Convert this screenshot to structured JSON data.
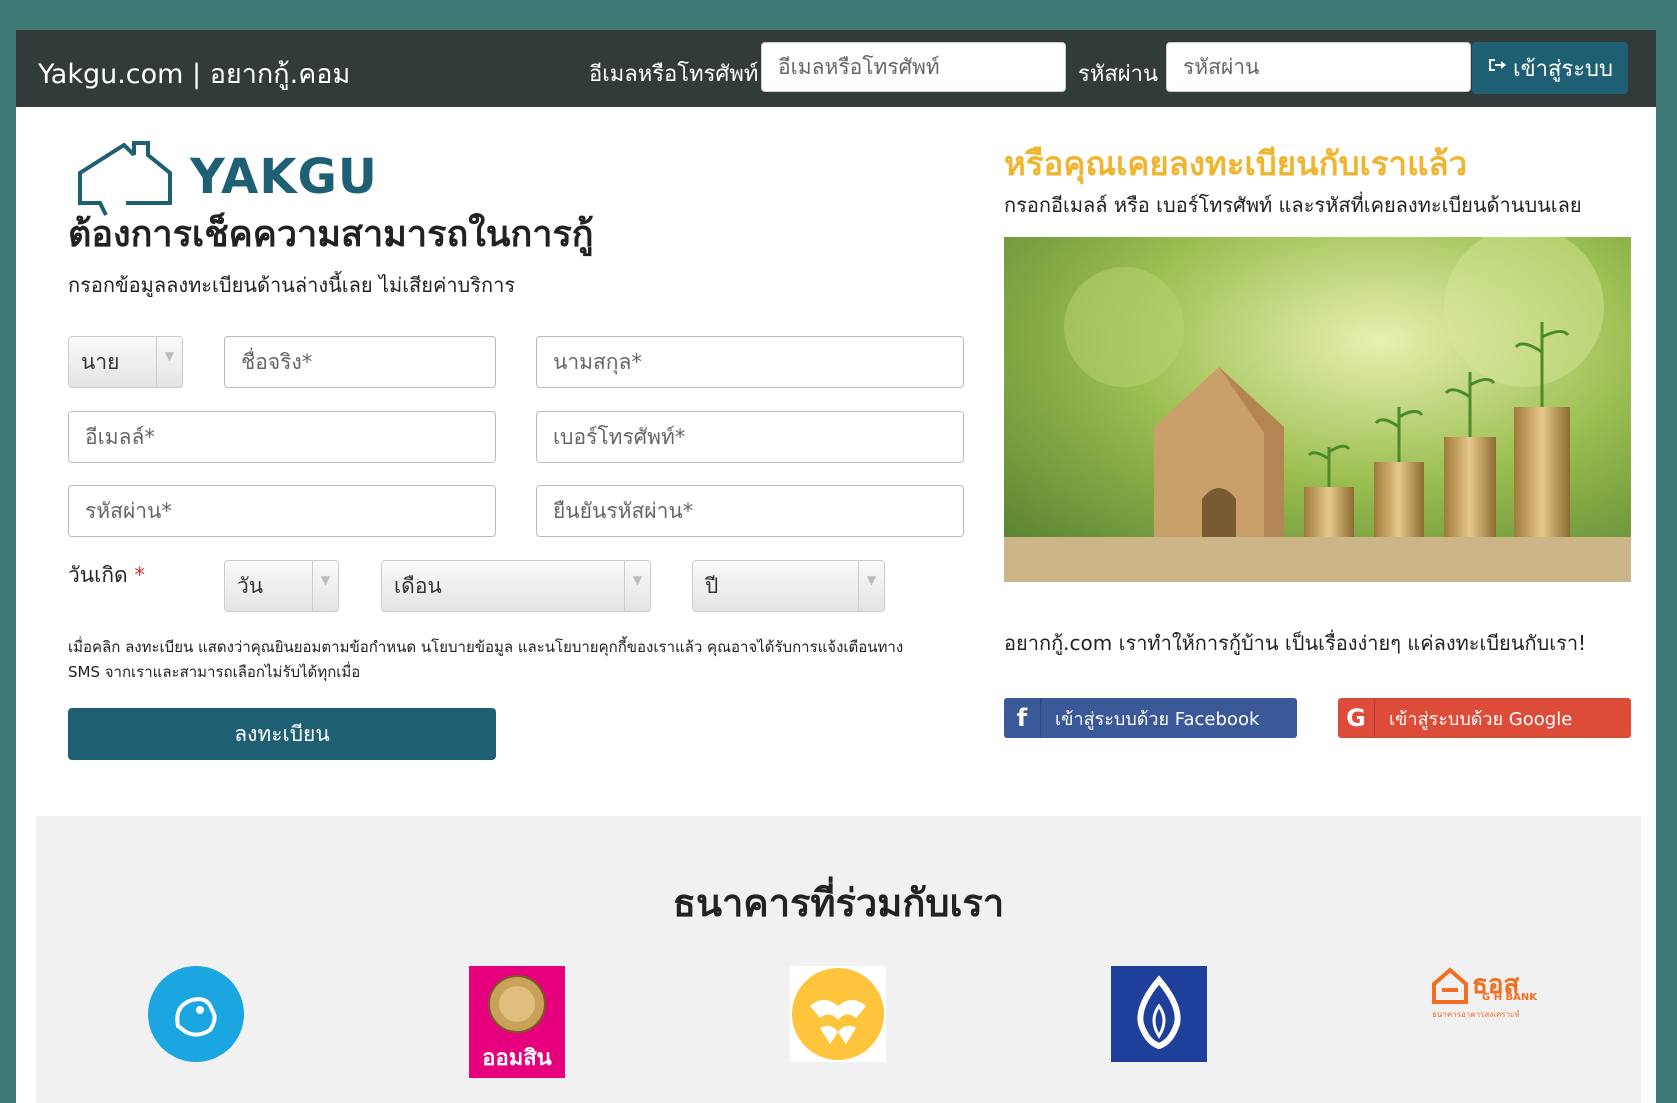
{
  "navbar": {
    "brand": "Yakgu.com | อยากกู้.คอม",
    "email_label": "อีเมลหรือโทรศัพท์",
    "email_placeholder": "อีเมลหรือโทรศัพท์",
    "password_label": "รหัสผ่าน",
    "password_placeholder": "รหัสผ่าน",
    "login_label": "เข้าสู่ระบบ"
  },
  "logo": {
    "text": "YAKGU"
  },
  "register": {
    "title": "ต้องการเช็คความสามารถในการกู้",
    "subtitle": "กรอกข้อมูลลงทะเบียนด้านล่างนี้เลย ไม่เสียค่าบริการ",
    "prefix_value": "นาย",
    "first_name": "ชื่อจริง*",
    "last_name": "นามสกุล*",
    "email": "อีเมลล์*",
    "phone": "เบอร์โทรศัพท์*",
    "password": "รหัสผ่าน*",
    "confirm_password": "ยืนยันรหัสผ่าน*",
    "dob_label": "วันเกิด",
    "dob_required": "*",
    "day": "วัน",
    "month": "เดือน",
    "year": "ปี",
    "terms": "เมื่อคลิก ลงทะเบียน แสดงว่าคุณยินยอมตามข้อกำหนด นโยบายข้อมูล และนโยบายคุกกี้ของเราแล้ว คุณอาจได้รับการแจ้งเตือนทาง SMS จากเราและสามารถเลือกไม่รับได้ทุกเมื่อ",
    "submit": "ลงทะเบียน"
  },
  "existing": {
    "title": "หรือคุณเคยลงทะเบียนกับเราแล้ว",
    "subtitle": "กรอกอีเมลล์ หรือ เบอร์โทรศัพท์ และรหัสที่เคยลงทะเบียนด้านบนเลย",
    "tagline": "อยากกู้.com เราทำให้การกู้บ้าน เป็นเรื่องง่ายๆ แค่ลงทะเบียนกับเรา!",
    "facebook_label": "เข้าสู่ระบบด้วย Facebook",
    "google_label": "เข้าสู่ระบบด้วย Google"
  },
  "banks": {
    "title": "ธนาคารที่ร่วมกับเรา",
    "gsb_text": "ออมสิน",
    "ghb_text": "ธอส",
    "ghb_sub": "G H BANK",
    "ghb_caption": "ธนาคารอาคารสงเคราะห์"
  },
  "colors": {
    "brand": "#1e5f73",
    "accent": "#f0b530",
    "facebook": "#3b5998",
    "google": "#dd4b39"
  }
}
